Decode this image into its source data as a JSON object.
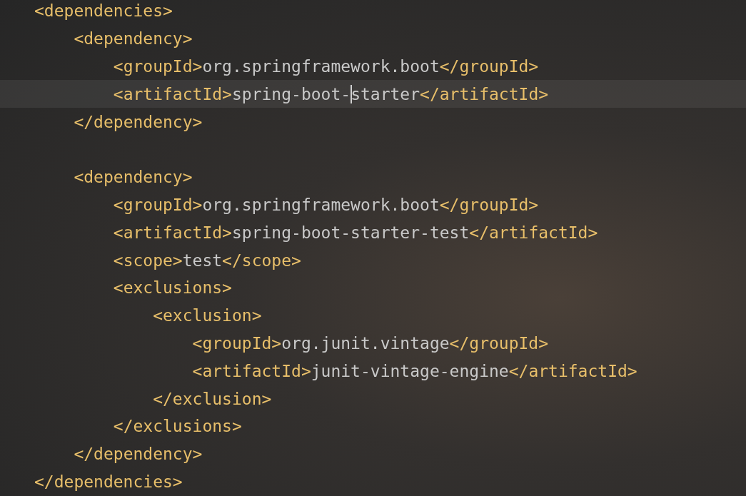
{
  "editor": {
    "lines": [
      {
        "kind": "code",
        "text": "<dependencies>"
      },
      {
        "kind": "code",
        "text": "    <dependency>"
      },
      {
        "kind": "code",
        "text": "        <groupId>org.springframework.boot</groupId>"
      },
      {
        "kind": "code",
        "text": "        <artifactId>spring-boot-",
        "current": true,
        "caret": true,
        "rest": "starter</artifactId>"
      },
      {
        "kind": "code",
        "text": "    </dependency>"
      },
      {
        "kind": "blank"
      },
      {
        "kind": "code",
        "text": "    <dependency>"
      },
      {
        "kind": "code",
        "text": "        <groupId>org.springframework.boot</groupId>"
      },
      {
        "kind": "code",
        "text": "        <artifactId>spring-boot-starter-test</artifactId>"
      },
      {
        "kind": "code",
        "text": "        <scope>test</scope>"
      },
      {
        "kind": "code",
        "text": "        <exclusions>"
      },
      {
        "kind": "code",
        "text": "            <exclusion>"
      },
      {
        "kind": "code",
        "text": "                <groupId>org.junit.vintage</groupId>"
      },
      {
        "kind": "code",
        "text": "                <artifactId>junit-vintage-engine</artifactId>"
      },
      {
        "kind": "code",
        "text": "            </exclusion>"
      },
      {
        "kind": "code",
        "text": "        </exclusions>"
      },
      {
        "kind": "code",
        "text": "    </dependency>"
      },
      {
        "kind": "code",
        "text": "</dependencies>"
      }
    ]
  }
}
